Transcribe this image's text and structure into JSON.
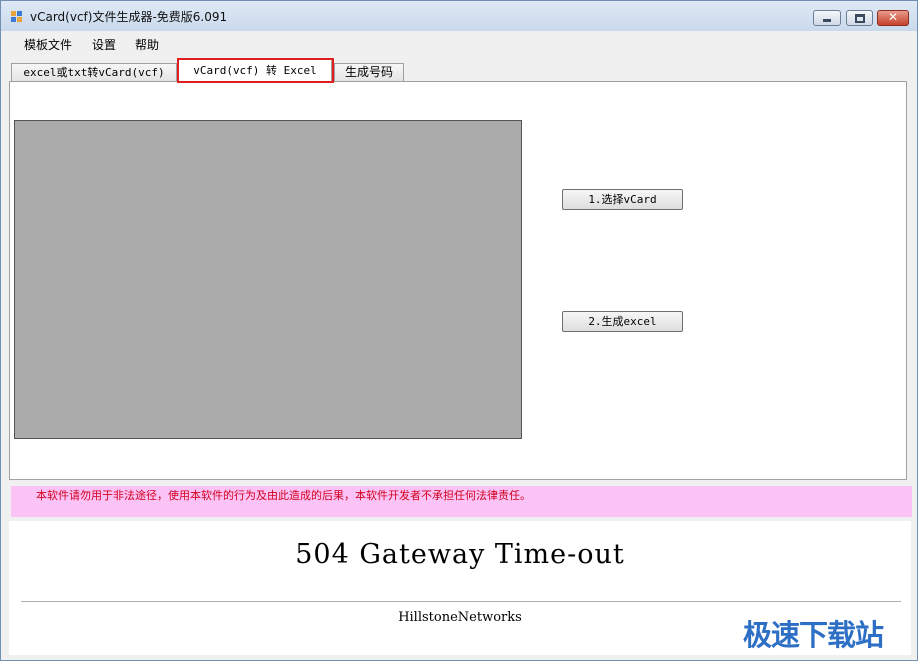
{
  "window": {
    "title": "vCard(vcf)文件生成器-免费版6.091",
    "controls": {
      "minimize_icon": "minimize-icon",
      "maximize_icon": "maximize-icon",
      "close_icon": "close-icon",
      "close_label": "✕"
    }
  },
  "menu": {
    "items": [
      {
        "label": "模板文件"
      },
      {
        "label": "设置"
      },
      {
        "label": "帮助"
      }
    ]
  },
  "tabs": [
    {
      "label": "excel或txt转vCard(vcf)",
      "active": false
    },
    {
      "label": "vCard(vcf) 转 Excel",
      "active": true
    },
    {
      "label": "生成号码",
      "active": false
    }
  ],
  "panel": {
    "select_button": "1.选择vCard",
    "generate_button": "2.生成excel"
  },
  "disclaimer": "本软件请勿用于非法途径，使用本软件的行为及由此造成的后果，本软件开发者不承担任何法律责任。",
  "error_page": {
    "title": "504 Gateway Time-out",
    "footer": "HillstoneNetworks"
  },
  "watermark": "极速下载站",
  "colors": {
    "highlight": "#e02020",
    "disclaimer_bg": "#fcc3f7",
    "disclaimer_text": "#d2001c",
    "watermark": "#2e6fc6"
  }
}
